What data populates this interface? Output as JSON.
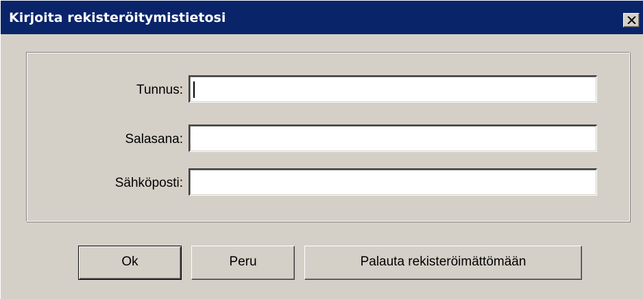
{
  "window": {
    "title": "Kirjoita rekisteröitymistietosi",
    "close_icon": "close-icon"
  },
  "form": {
    "username": {
      "label": "Tunnus:",
      "value": ""
    },
    "password": {
      "label": "Salasana:",
      "value": ""
    },
    "email": {
      "label": "Sähköposti:",
      "value": ""
    }
  },
  "buttons": {
    "ok": "Ok",
    "cancel": "Peru",
    "reset": "Palauta rekisteröimättömään"
  },
  "colors": {
    "titlebar": "#0a246a",
    "face": "#d4d0c8",
    "title_text": "#ffffff"
  }
}
